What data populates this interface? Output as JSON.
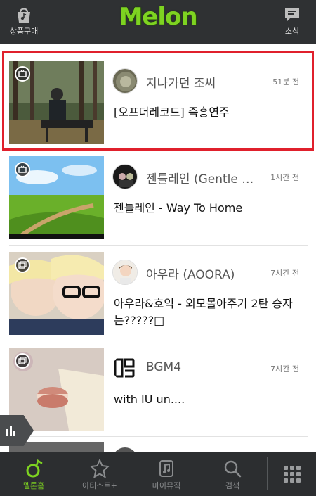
{
  "topbar": {
    "left_label": "상품구매",
    "logo_text": "Melon",
    "right_label": "소식"
  },
  "feed": [
    {
      "thumb": "video-thumb-nature",
      "author": "지나가던 조씨",
      "time": "51분 전",
      "title": "[오프더레코드] 즉흥연주",
      "type": "video"
    },
    {
      "thumb": "video-thumb-field",
      "author": "젠틀레인 (Gentle …",
      "time": "1시간 전",
      "title": "젠틀레인 - Way To Home",
      "type": "video"
    },
    {
      "thumb": "album-thumb-selfie",
      "author": "아우라 (AOORA)",
      "time": "7시간 전",
      "title": "아우라&호익 - 외모몰아주기 2탄 승자는?????□",
      "type": "album"
    },
    {
      "thumb": "album-thumb-macaron",
      "author": "BGM4",
      "time": "7시간 전",
      "title": "with IU un....",
      "type": "album"
    }
  ],
  "bottomnav": [
    {
      "label": "멜론홈",
      "active": true
    },
    {
      "label": "아티스트+",
      "active": false
    },
    {
      "label": "마이뮤직",
      "active": false
    },
    {
      "label": "검색",
      "active": false
    }
  ],
  "colors": {
    "accent": "#7ed321",
    "highlight": "#e0202c",
    "bar": "#2f3133"
  }
}
